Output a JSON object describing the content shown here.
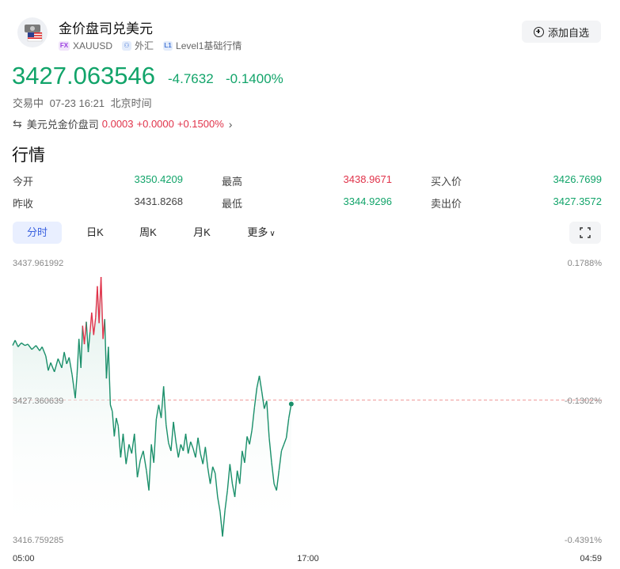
{
  "header": {
    "title": "金价盘司兑美元",
    "tags": [
      {
        "icon": "FX",
        "label": "XAUUSD"
      },
      {
        "icon": "forex-icon",
        "label": "外汇"
      },
      {
        "icon": "L1",
        "label": "Level1基础行情"
      }
    ],
    "add_button": "添加自选"
  },
  "quote": {
    "price": "3427.063546",
    "change": "-4.7632",
    "change_pct": "-0.1400%",
    "status": "交易中",
    "datetime": "07-23 16:21",
    "timezone": "北京时间"
  },
  "related": {
    "name": "美元兑金价盘司",
    "price": "0.0003",
    "change": "+0.0000",
    "change_pct": "+0.1500%"
  },
  "section_title": "行情",
  "stats": [
    {
      "label": "今开",
      "value": "3350.4209",
      "color": "green"
    },
    {
      "label": "最高",
      "value": "3438.9671",
      "color": "red"
    },
    {
      "label": "买入价",
      "value": "3426.7699",
      "color": "green"
    },
    {
      "label": "昨收",
      "value": "3431.8268",
      "color": "gray"
    },
    {
      "label": "最低",
      "value": "3344.9296",
      "color": "green"
    },
    {
      "label": "卖出价",
      "value": "3427.3572",
      "color": "green"
    }
  ],
  "tabs": [
    "分时",
    "日K",
    "周K",
    "月K",
    "更多"
  ],
  "active_tab": "分时",
  "colors": {
    "up": "#e0334a",
    "down": "#12a46a",
    "accent": "#3c63e0"
  },
  "chart_data": {
    "type": "line",
    "y_axis_left": [
      "3437.961992",
      "3427.360639",
      "3416.759285"
    ],
    "y_axis_right": [
      "0.1788%",
      "-0.1302%",
      "-0.4391%"
    ],
    "x_axis_labels": [
      "05:00",
      "17:00",
      "04:59"
    ],
    "ylim": [
      3416.759285,
      3437.961992
    ],
    "prev_close": 3427.360639,
    "x_range_hours": [
      0,
      24
    ],
    "series": [
      {
        "x": [
          0.0,
          0.1,
          0.22,
          0.35,
          0.5,
          0.62,
          0.78,
          0.95,
          1.1,
          1.2,
          1.35,
          1.45,
          1.55,
          1.7,
          1.85,
          2.0,
          2.1,
          2.2,
          2.3,
          2.42,
          2.55,
          2.62,
          2.7,
          2.78,
          2.85,
          2.92,
          3.0,
          3.08,
          3.15,
          3.22,
          3.3,
          3.38,
          3.45,
          3.52,
          3.6,
          3.68,
          3.75,
          3.82,
          3.9,
          3.98,
          4.06,
          4.14,
          4.22,
          4.3,
          4.4,
          4.5,
          4.62,
          4.74,
          4.85,
          4.96,
          5.08,
          5.2,
          5.32,
          5.45,
          5.55,
          5.65,
          5.75,
          5.85,
          5.95,
          6.05,
          6.15,
          6.25,
          6.35,
          6.45,
          6.55,
          6.65,
          6.75,
          6.85,
          6.95,
          7.05,
          7.15,
          7.25,
          7.35,
          7.45,
          7.55,
          7.65,
          7.75,
          7.85,
          7.95,
          8.05,
          8.15,
          8.25,
          8.35,
          8.45,
          8.55,
          8.65,
          8.75,
          8.85,
          8.95,
          9.05,
          9.15,
          9.25,
          9.35,
          9.45,
          9.55,
          9.65,
          9.75,
          9.85,
          9.95,
          10.05,
          10.15,
          10.25,
          10.35,
          10.45,
          10.55,
          10.65,
          10.75,
          10.85,
          10.95,
          11.05,
          11.15,
          11.25,
          11.35
        ],
        "y": [
          3431.5,
          3431.9,
          3431.4,
          3431.7,
          3431.5,
          3431.6,
          3431.2,
          3431.5,
          3431.1,
          3431.4,
          3430.7,
          3429.6,
          3430.2,
          3429.5,
          3430.5,
          3429.8,
          3431.0,
          3430.1,
          3430.6,
          3429.3,
          3427.5,
          3429.2,
          3432.0,
          3429.8,
          3433.0,
          3431.6,
          3433.3,
          3431.0,
          3432.5,
          3434.0,
          3432.3,
          3433.6,
          3436.0,
          3433.2,
          3436.7,
          3432.0,
          3433.5,
          3429.0,
          3431.4,
          3427.0,
          3426.5,
          3424.6,
          3426.0,
          3425.4,
          3423.0,
          3424.8,
          3422.5,
          3424.0,
          3423.3,
          3424.8,
          3421.5,
          3422.8,
          3423.5,
          3422.0,
          3420.5,
          3424.0,
          3422.6,
          3425.9,
          3427.0,
          3426.0,
          3428.4,
          3425.5,
          3424.1,
          3423.5,
          3425.7,
          3424.2,
          3423.0,
          3424.0,
          3423.5,
          3424.8,
          3423.3,
          3424.2,
          3423.7,
          3423.0,
          3424.5,
          3423.3,
          3422.5,
          3423.8,
          3422.2,
          3421.0,
          3422.3,
          3421.8,
          3420.0,
          3418.9,
          3417.0,
          3419.0,
          3420.5,
          3422.5,
          3421.0,
          3420.0,
          3422.0,
          3421.0,
          3423.5,
          3422.6,
          3424.6,
          3424.0,
          3425.1,
          3426.8,
          3428.3,
          3429.2,
          3428.0,
          3426.7,
          3427.3,
          3424.5,
          3422.6,
          3421.0,
          3420.5,
          3422.0,
          3423.5,
          3424.0,
          3424.5,
          3426.0,
          3427.06
        ]
      }
    ]
  }
}
